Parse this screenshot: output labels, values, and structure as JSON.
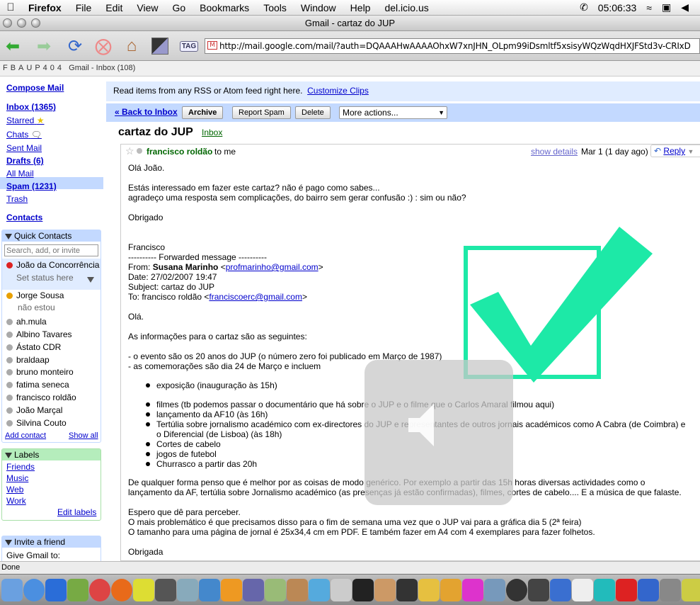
{
  "menubar": {
    "app": "Firefox",
    "items": [
      "File",
      "Edit",
      "View",
      "Go",
      "Bookmarks",
      "Tools",
      "Window",
      "Help",
      "del.icio.us"
    ],
    "clock": "05:06:33"
  },
  "window": {
    "title": "Gmail - cartaz do JUP"
  },
  "toolbar": {
    "url": "http://mail.google.com/mail/?auth=DQAAAHwAAAAOhxW7xnJHN_OLpm99iDsmltf5xsisyWQzWqdHXJFStd3v-CRIxD",
    "tag_label": "TAG"
  },
  "tabstrip": {
    "host": "FBAUP404",
    "title": "Gmail - Inbox (108)"
  },
  "sidebar": {
    "compose": "Compose Mail",
    "inbox": "Inbox (1365)",
    "starred": "Starred",
    "chats": "Chats",
    "sent": "Sent Mail",
    "drafts": "Drafts (6)",
    "all": "All Mail",
    "spam": "Spam (1231)",
    "trash": "Trash",
    "contacts": "Contacts",
    "quick_contacts": {
      "title": "Quick Contacts",
      "search_placeholder": "Search, add, or invite",
      "me": {
        "name": "João da Concorrência",
        "status": "Set status here"
      },
      "jorge": {
        "name": "Jorge Sousa",
        "status": "não estou"
      },
      "list": [
        "ah.mula",
        "Albino Tavares",
        "Ástato CDR",
        "braldaap",
        "bruno monteiro",
        "fatima seneca",
        "francisco roldão",
        "João Marçal",
        "Silvina Couto"
      ],
      "add": "Add contact",
      "show_all": "Show all"
    },
    "labels": {
      "title": "Labels",
      "items": [
        "Friends",
        "Music",
        "Web",
        "Work"
      ],
      "edit": "Edit labels"
    },
    "invite": {
      "title": "Invite a friend",
      "text": "Give Gmail to:"
    }
  },
  "main": {
    "clips_text": "Read items from any RSS or Atom feed right here.",
    "clips_link": "Customize Clips",
    "back": "« Back to Inbox",
    "archive": "Archive",
    "report_spam": "Report Spam",
    "delete": "Delete",
    "more_actions": "More actions...",
    "subject": "cartaz do JUP",
    "subject_label": "Inbox",
    "sender": "francisco roldão",
    "to": "to me",
    "show_details": "show details",
    "date": "Mar 1 (1 day ago)",
    "reply": "Reply",
    "body": {
      "l1": "Olá João.",
      "l2": "Estás interessado em fazer este cartaz? não é pago como sabes...",
      "l3": "agradeço uma resposta sem complicações, do bairro sem gerar confusão :) : sim ou não?",
      "l4": "Obrigado",
      "l5": "Francisco",
      "l6": "---------- Forwarded message ----------",
      "from_label": "From:",
      "from_name": "Susana Marinho",
      "from_email": "profmarinho@gmail.com",
      "date_line": "Date: 27/02/2007 19:47",
      "subject_line": "Subject: cartaz do JUP",
      "to_prefix": "To: francisco roldão <",
      "to_email": "franciscoerc@gmail.com",
      "l7": "Olá.",
      "l8": "As informações para o cartaz são as seguintes:",
      "l9": "- o evento são os 20 anos do JUP (o número zero foi publicado em Março de 1987)",
      "l10": "- as comemorações são dia 24 de Março e incluem",
      "b1": "exposição (inauguração às 15h)",
      "b2": "filmes (tb podemos passar o documentário que há sobre o JUP e o filme que o Carlos Amaral filmou aqui)",
      "b3": "lançamento da AF10 (às 16h)",
      "b4": "Tertúlia sobre jornalismo académico com ex-directores do JUP e representantes de outros jornais académicos como A Cabra (de Coimbra) e",
      "b4b": "o Diferencial (de Lisboa) (às 18h)",
      "b5": "Cortes de cabelo",
      "b6": "jogos de futebol",
      "b7": "Churrasco a partir das 20h",
      "p1": "De qualquer forma penso que é melhor por as coisas de modo genérico. Por exemplo a partir das 15h horas diversas actividades como o",
      "p2": "lançamento da AF, tertúlia sobre Jornalismo académico (as presenças já estão confirmadas), filmes, cortes de cabelo.... E a música de que falaste.",
      "p3": "Espero que dê para perceber.",
      "p4": "O mais problemático é que precisamos disso para o fim de semana uma vez que o JUP vai para a gráfica dia 5 (2ª feira)",
      "p5": "O tamanho para uma página de jornal é 25x34,4 cm em PDF. E também fazer em A4 com 4 exemplares para fazer folhetos.",
      "p6": "Obrigada"
    }
  },
  "status": {
    "text": "Done"
  },
  "colors": {
    "gmail_blue": "#c3d9ff",
    "clips_blue": "#e0ecff",
    "labels_green": "#b5edbc",
    "check_green": "#1de9a7"
  }
}
